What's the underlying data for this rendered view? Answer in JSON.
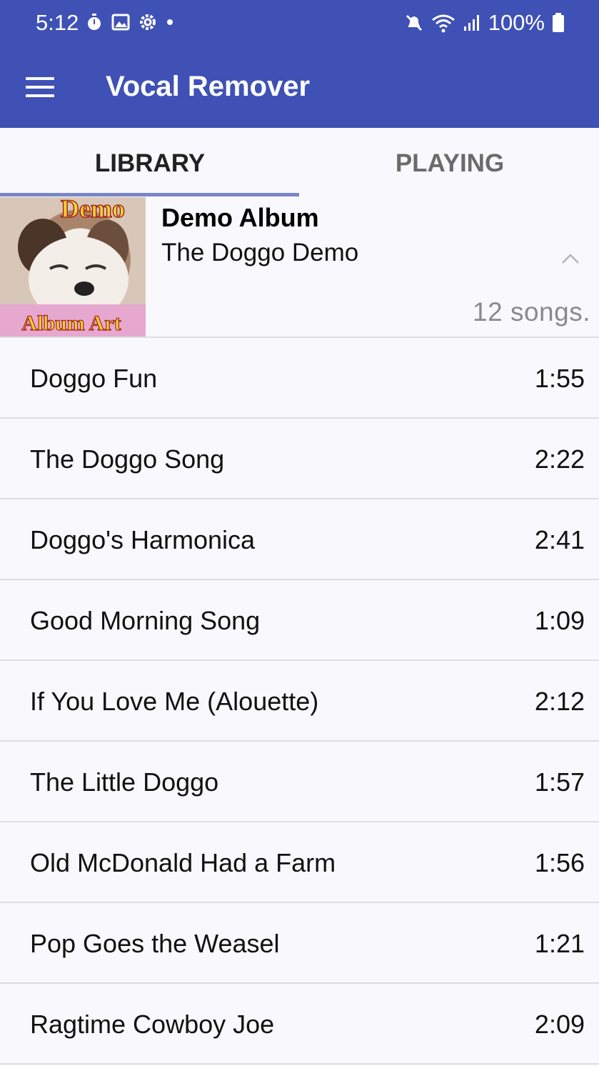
{
  "status_bar": {
    "time": "5:12",
    "battery": "100%",
    "icons": [
      "timer-icon",
      "gallery-icon",
      "settings-icon",
      "dot-icon",
      "mute-icon",
      "wifi-icon",
      "signal-icon",
      "battery-icon"
    ]
  },
  "app_bar": {
    "title": "Vocal Remover",
    "menu_icon": "hamburger-menu-icon",
    "color": "#3f51b5"
  },
  "tabs": [
    {
      "label": "LIBRARY",
      "selected": true
    },
    {
      "label": "PLAYING",
      "selected": false
    }
  ],
  "album": {
    "name": "Demo Album",
    "artist": "The Doggo Demo",
    "song_count": "12 songs.",
    "art_top_text": "Demo",
    "art_bottom_text": "Album Art",
    "expanded": true
  },
  "songs": [
    {
      "title": "Doggo Fun",
      "duration": "1:55"
    },
    {
      "title": "The Doggo Song",
      "duration": "2:22"
    },
    {
      "title": "Doggo's Harmonica",
      "duration": "2:41"
    },
    {
      "title": "Good Morning Song",
      "duration": "1:09"
    },
    {
      "title": "If You Love Me (Alouette)",
      "duration": "2:12"
    },
    {
      "title": "The Little Doggo",
      "duration": "1:57"
    },
    {
      "title": "Old McDonald Had a Farm",
      "duration": "1:56"
    },
    {
      "title": "Pop Goes the Weasel",
      "duration": "1:21"
    },
    {
      "title": "Ragtime Cowboy Joe",
      "duration": "2:09"
    }
  ]
}
